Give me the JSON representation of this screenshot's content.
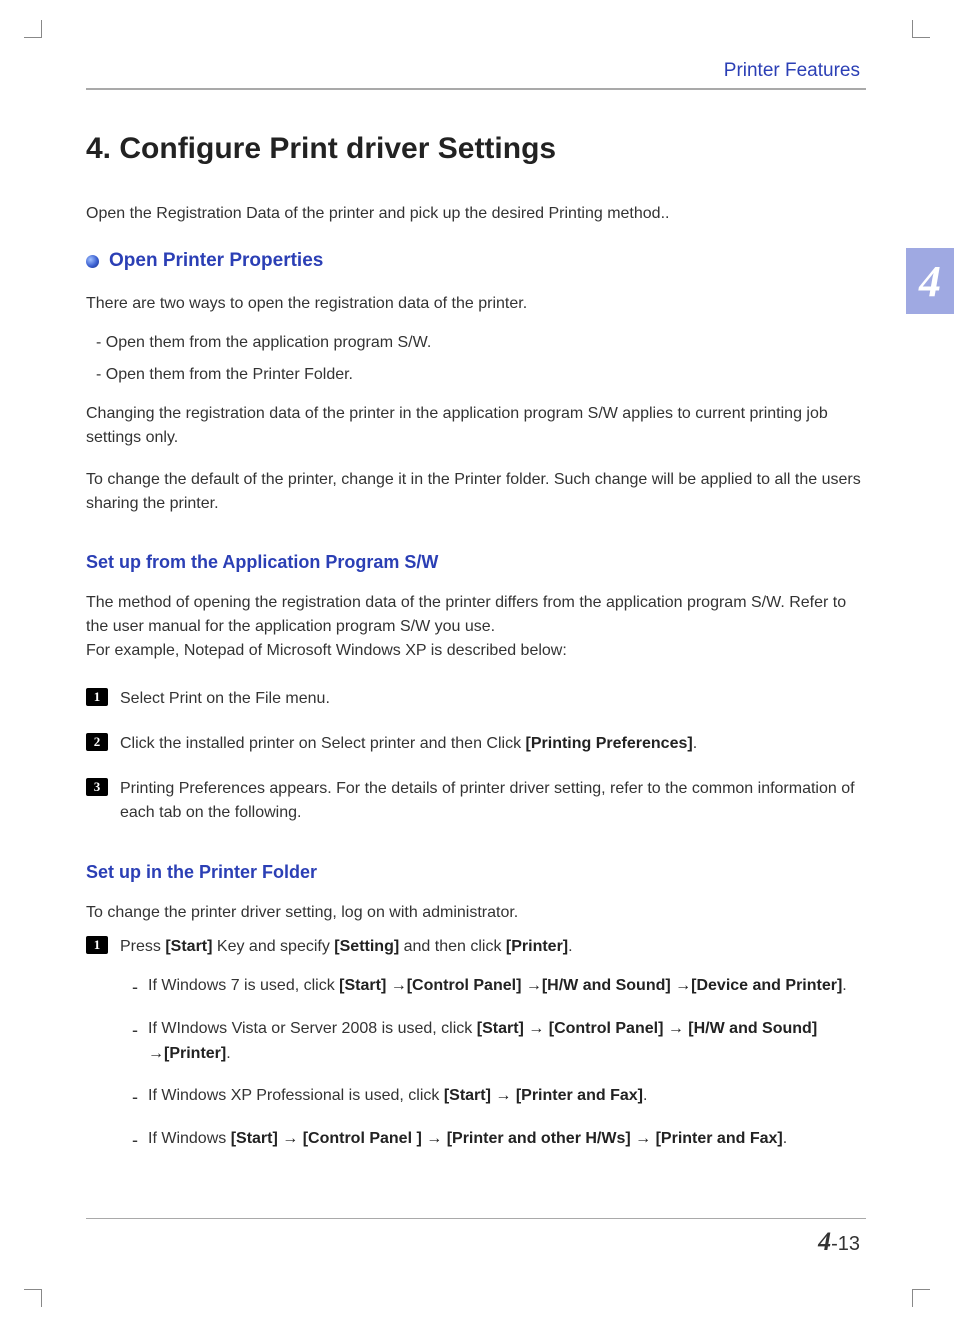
{
  "header": {
    "title": "Printer Features"
  },
  "chapter_tab": "4",
  "title": {
    "number": "4.",
    "text": "Configure Print driver Settings"
  },
  "intro": "Open the Registration Data of the printer and pick up the desired Printing method..",
  "section1": {
    "heading": "Open Printer Properties",
    "p1": "There are two ways to open the registration data of the printer.",
    "dashes": [
      "Open them from the application program S/W.",
      "Open them from the Printer Folder."
    ],
    "p2": "Changing the registration data of the printer in the application program S/W applies to current printing job settings only.",
    "p3": "To change the default of the printer, change it in the Printer folder. Such change will be applied to all the users sharing the printer."
  },
  "section2": {
    "heading": "Set up from the Application Program S/W",
    "p1": "The method of opening the registration data of the printer differs from the application program S/W. Refer to the user manual for the application program S/W you use.",
    "p2": "For example, Notepad of Microsoft Windows XP is described below:",
    "steps": {
      "s1": "Select Print on the File menu.",
      "s2a": "Click the installed printer on Select printer and then Click ",
      "s2b": "[Printing Preferences]",
      "s2c": ".",
      "s3": "Printing Preferences appears. For the details of printer driver setting, refer to the common information of each tab on the following."
    }
  },
  "section3": {
    "heading": "Set up in the Printer Folder",
    "p1": "To change the printer driver setting, log on with administrator.",
    "step1": {
      "a": "Press ",
      "b": "[Start]",
      "c": " Key and specify ",
      "d": "[Setting]",
      "e": " and then click ",
      "f": "[Printer]",
      "g": "."
    },
    "sub": {
      "i1": {
        "a": "If Windows 7 is used, click ",
        "b": "[Start] →[Control Panel] →[H/W and Sound] →[Device and Printer]",
        "c": "."
      },
      "i2": {
        "a": "If WIndows  Vista or Server 2008 is used, click  ",
        "b": "[Start] → [Control Panel] → [H/W and Sound] →[Printer]",
        "c": "."
      },
      "i3": {
        "a": "If Windows XP Professional is used, click  ",
        "b": "[Start] → [Printer and Fax]",
        "c": "."
      },
      "i4": {
        "a": "If Windows ",
        "b": "[Start] → [Control Panel ] → [Printer and other H/Ws] → [Printer and  Fax]",
        "c": "."
      }
    }
  },
  "footer": {
    "chapter": "4",
    "sep": "-",
    "page": "13"
  }
}
